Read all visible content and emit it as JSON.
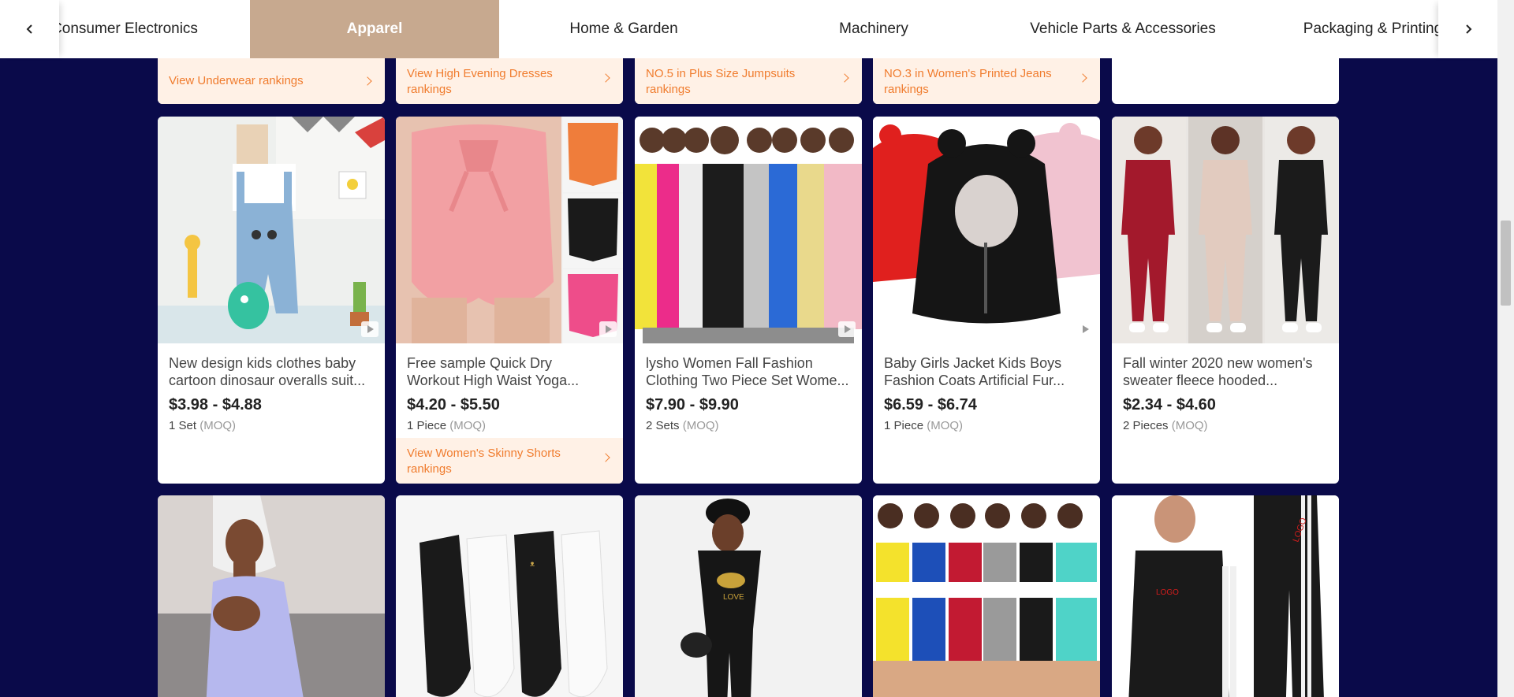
{
  "nav": {
    "tabs": [
      {
        "label": "Consumer Electronics",
        "active": false
      },
      {
        "label": "Apparel",
        "active": true
      },
      {
        "label": "Home & Garden",
        "active": false
      },
      {
        "label": "Machinery",
        "active": false
      },
      {
        "label": "Vehicle Parts & Accessories",
        "active": false
      },
      {
        "label": "Packaging & Printing",
        "active": false
      }
    ],
    "prev_icon": "chevron-left-icon",
    "next_icon": "chevron-right-icon",
    "active_color": "#c7a98f"
  },
  "colors": {
    "background": "#0a0a4a",
    "rank_text": "#f07c2e",
    "rank_bg": "#fff1e6"
  },
  "top_row_links": [
    "View Underwear rankings",
    "View High Evening Dresses rankings",
    "NO.5 in Plus Size Jumpsuits rankings",
    "NO.3 in Women's Printed Jeans rankings"
  ],
  "products": [
    {
      "title_line1": "New design kids clothes baby",
      "title_line2": "cartoon dinosaur overalls suit...",
      "price": "$3.98 - $4.88",
      "moq": "1 Set",
      "moq_tag": "(MOQ)",
      "has_video": true,
      "icon": "play-video-icon"
    },
    {
      "title_line1": "Free sample Quick Dry",
      "title_line2": "Workout High Waist Yoga...",
      "price": "$4.20 - $5.50",
      "moq": "1 Piece",
      "moq_tag": "(MOQ)",
      "has_video": true,
      "rank_link": "View Women's Skinny Shorts rankings"
    },
    {
      "title_line1": "lysho Women Fall Fashion",
      "title_line2": "Clothing Two Piece Set Wome...",
      "price": "$7.90 - $9.90",
      "moq": "2 Sets",
      "moq_tag": "(MOQ)",
      "has_video": true
    },
    {
      "title_line1": "Baby Girls Jacket Kids Boys",
      "title_line2": "Fashion Coats Artificial Fur...",
      "price": "$6.59 - $6.74",
      "moq": "1 Piece",
      "moq_tag": "(MOQ)",
      "has_video": true
    },
    {
      "title_line1": "Fall winter 2020 new women's",
      "title_line2": "sweater fleece hooded...",
      "price": "$2.34 - $4.60",
      "moq": "2 Pieces",
      "moq_tag": "(MOQ)",
      "has_video": false
    }
  ],
  "bottom_row_images": [
    "lavender-bodycon-dress-image",
    "black-white-socks-image",
    "black-lips-print-outfit-image",
    "colorful-crop-top-shorts-sets-image",
    "black-tracksuit-image"
  ],
  "image_texts": {
    "tracksuit_logo": "LOGO",
    "tshirt_print": "LOVE"
  }
}
